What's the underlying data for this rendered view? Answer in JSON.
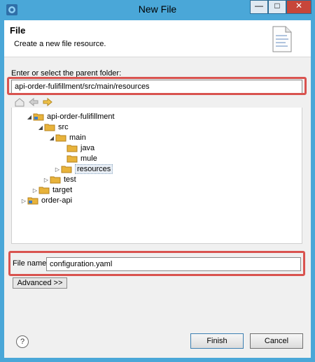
{
  "window": {
    "title": "New File"
  },
  "header": {
    "title": "File",
    "description": "Create a new file resource."
  },
  "parent_folder": {
    "label": "Enter or select the parent folder:",
    "value": "api-order-fulifillment/src/main/resources"
  },
  "tree": {
    "nodes": [
      {
        "label": "api-order-fulifillment",
        "arrow": "◢"
      },
      {
        "label": "src",
        "arrow": "◢"
      },
      {
        "label": "main",
        "arrow": "◢"
      },
      {
        "label": "java",
        "arrow": ""
      },
      {
        "label": "mule",
        "arrow": ""
      },
      {
        "label": "resources",
        "arrow": "▷"
      },
      {
        "label": "test",
        "arrow": "▷"
      },
      {
        "label": "target",
        "arrow": "▷"
      },
      {
        "label": "order-api",
        "arrow": "▷"
      }
    ]
  },
  "file_name": {
    "label": "File name:",
    "value": "configuration.yaml"
  },
  "buttons": {
    "advanced": "Advanced >>",
    "finish": "Finish",
    "cancel": "Cancel",
    "help": "?"
  },
  "window_controls": {
    "minimize": "—",
    "maximize": "□",
    "close": "✕"
  },
  "colors": {
    "title_bar": "#4aa7d8",
    "highlight": "#d9534f",
    "folder": "#e8b33b"
  }
}
